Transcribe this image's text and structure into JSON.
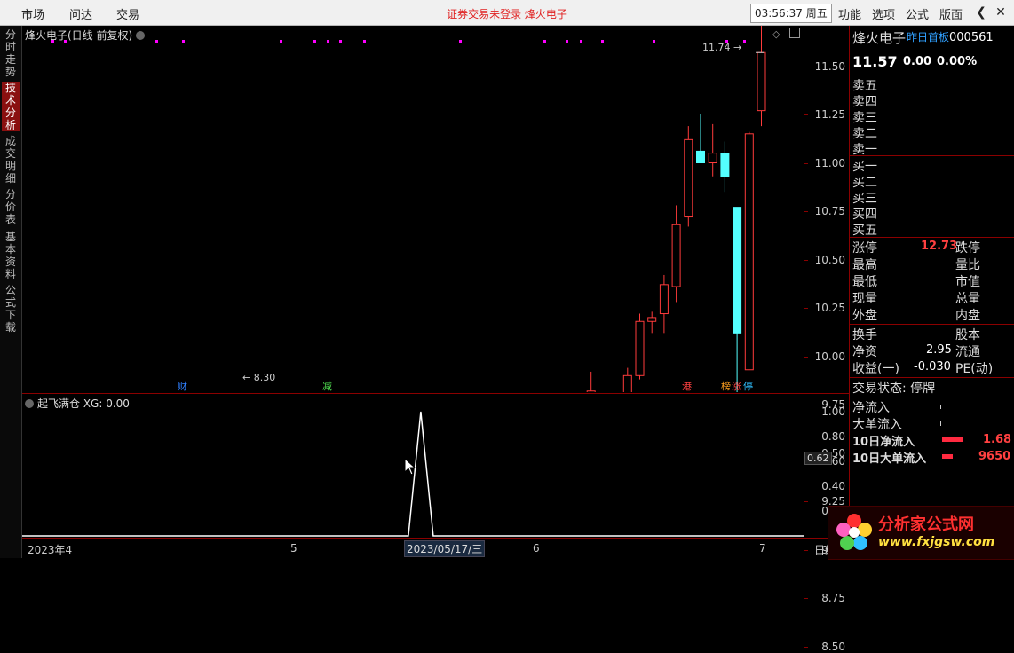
{
  "topbar": {
    "menus": [
      "市场",
      "问达",
      "交易"
    ],
    "center_title": "证券交易未登录   烽火电子",
    "clock": "03:56:37 周五",
    "right_menus": [
      "功能",
      "选项",
      "公式",
      "版面"
    ],
    "btn_back": "❮",
    "btn_close": "✕"
  },
  "vtabs": [
    {
      "label": "分时走势",
      "active": false
    },
    {
      "label": "技术分析",
      "active": true
    },
    {
      "label": "成交明细",
      "active": false
    },
    {
      "label": "分价表",
      "active": false
    },
    {
      "label": "基本资料",
      "active": false
    },
    {
      "label": "公式下载",
      "active": false
    }
  ],
  "main": {
    "title": "烽火电子(日线 前复权)",
    "max_label": "11.74",
    "min_label": "8.30",
    "y_ticks": [
      "11.50",
      "11.25",
      "11.00",
      "10.75",
      "10.50",
      "10.25",
      "10.00",
      "9.75",
      "9.50",
      "9.25",
      "9.00",
      "8.75",
      "8.50"
    ],
    "events": [
      "财",
      "减",
      "港",
      "榜",
      "涨",
      "停"
    ]
  },
  "sub": {
    "title": "起飞满仓  XG: 0.00",
    "y_ticks": [
      "1.00",
      "0.80",
      "0.60",
      "0.40",
      "0.20"
    ],
    "cursor_value": "0.62"
  },
  "xaxis": {
    "labels": [
      "2023年4",
      "5",
      "6",
      "7"
    ],
    "selected": "2023/05/17/三",
    "right_label": "日线"
  },
  "right_panel": {
    "name": "烽火电子",
    "tag": "昨日首板",
    "code": "000561",
    "price": "11.57",
    "change": "0.00",
    "change_pct": "0.00%",
    "sells": [
      "卖五",
      "卖四",
      "卖三",
      "卖二",
      "卖一"
    ],
    "buys": [
      "买一",
      "买二",
      "买三",
      "买四",
      "买五"
    ],
    "limit_up_label": "涨停",
    "limit_up_value": "12.73",
    "limit_down_label": "跌停",
    "rows_left": [
      "最高",
      "最低",
      "现量",
      "外盘"
    ],
    "rows_right": [
      "量比",
      "市值",
      "总量",
      "内盘"
    ],
    "turnover_label": "换手",
    "equity_label": "股本",
    "net_asset_label": "净资",
    "net_asset_value": "2.95",
    "float_label": "流通",
    "eps_label": "收益(一)",
    "eps_value": "-0.030",
    "pe_label": "PE(动)",
    "trade_status": "交易状态: 停牌",
    "flow_rows": [
      {
        "label": "净流入",
        "value": ""
      },
      {
        "label": "大单流入",
        "value": ""
      },
      {
        "label": "10日净流入",
        "value": "1.68"
      },
      {
        "label": "10日大单流入",
        "value": "9650"
      }
    ]
  },
  "logo": {
    "title": "分析家公式网",
    "url": "www.fxjgsw.com"
  },
  "colors": {
    "up": "#ff3b3b",
    "down": "#54ffff",
    "accent": "#8b0000",
    "marker": "#ff00ff"
  },
  "chart_data": {
    "type": "candlestick",
    "series": [
      {
        "o": 9.38,
        "h": 9.42,
        "l": 9.32,
        "c": 9.38
      },
      {
        "o": 9.4,
        "h": 9.42,
        "l": 9.14,
        "c": 9.2
      },
      {
        "o": 9.22,
        "h": 9.41,
        "l": 9.2,
        "c": 9.38
      },
      {
        "o": 9.38,
        "h": 9.54,
        "l": 9.35,
        "c": 9.48
      },
      {
        "o": 9.48,
        "h": 9.48,
        "l": 9.26,
        "c": 9.28
      },
      {
        "o": 9.27,
        "h": 9.36,
        "l": 9.22,
        "c": 9.33
      },
      {
        "o": 9.32,
        "h": 9.45,
        "l": 9.28,
        "c": 9.45
      },
      {
        "o": 9.44,
        "h": 9.44,
        "l": 9.2,
        "c": 9.21
      },
      {
        "o": 9.2,
        "h": 9.2,
        "l": 9.07,
        "c": 9.17
      },
      {
        "o": 9.18,
        "h": 9.35,
        "l": 9.16,
        "c": 9.33
      },
      {
        "o": 9.33,
        "h": 9.4,
        "l": 9.3,
        "c": 9.37
      },
      {
        "o": 9.35,
        "h": 9.44,
        "l": 9.33,
        "c": 9.38
      },
      {
        "o": 9.38,
        "h": 9.48,
        "l": 9.36,
        "c": 9.44
      },
      {
        "o": 9.4,
        "h": 9.4,
        "l": 9.12,
        "c": 9.12
      },
      {
        "o": 9.11,
        "h": 9.13,
        "l": 8.99,
        "c": 9.0
      },
      {
        "o": 8.97,
        "h": 9.05,
        "l": 8.92,
        "c": 8.97
      },
      {
        "o": 8.95,
        "h": 9.07,
        "l": 8.72,
        "c": 8.8
      },
      {
        "o": 8.78,
        "h": 8.82,
        "l": 8.69,
        "c": 8.74
      },
      {
        "o": 8.72,
        "h": 8.76,
        "l": 8.36,
        "c": 8.45
      },
      {
        "o": 8.43,
        "h": 8.65,
        "l": 8.4,
        "c": 8.55
      },
      {
        "o": 8.56,
        "h": 8.74,
        "l": 8.52,
        "c": 8.7
      },
      {
        "o": 8.62,
        "h": 8.85,
        "l": 8.6,
        "c": 8.83
      },
      {
        "o": 8.8,
        "h": 8.97,
        "l": 8.74,
        "c": 8.8
      },
      {
        "o": 8.73,
        "h": 8.87,
        "l": 8.7,
        "c": 8.82
      },
      {
        "o": 8.83,
        "h": 9.0,
        "l": 8.78,
        "c": 8.98
      },
      {
        "o": 9.03,
        "h": 9.09,
        "l": 8.83,
        "c": 8.86
      },
      {
        "o": 8.83,
        "h": 8.93,
        "l": 8.8,
        "c": 8.89
      },
      {
        "o": 8.88,
        "h": 9.02,
        "l": 8.85,
        "c": 8.98
      },
      {
        "o": 8.99,
        "h": 9.0,
        "l": 8.86,
        "c": 8.9
      },
      {
        "o": 8.93,
        "h": 8.97,
        "l": 8.74,
        "c": 8.95
      },
      {
        "o": 8.83,
        "h": 8.91,
        "l": 8.8,
        "c": 8.88
      },
      {
        "o": 8.9,
        "h": 9.09,
        "l": 8.87,
        "c": 9.06
      },
      {
        "o": 9.09,
        "h": 9.19,
        "l": 9.03,
        "c": 9.15
      },
      {
        "o": 9.16,
        "h": 9.18,
        "l": 9.1,
        "c": 9.15
      },
      {
        "o": 9.25,
        "h": 9.25,
        "l": 9.13,
        "c": 9.14
      },
      {
        "o": 9.14,
        "h": 9.16,
        "l": 8.99,
        "c": 9.03
      },
      {
        "o": 8.96,
        "h": 9.1,
        "l": 8.92,
        "c": 8.99
      },
      {
        "o": 8.98,
        "h": 9.12,
        "l": 8.91,
        "c": 9.07
      },
      {
        "o": 9.03,
        "h": 9.13,
        "l": 9.02,
        "c": 9.1
      },
      {
        "o": 9.14,
        "h": 9.16,
        "l": 9.0,
        "c": 9.03
      },
      {
        "o": 8.95,
        "h": 9.05,
        "l": 8.89,
        "c": 9.04
      },
      {
        "o": 9.01,
        "h": 9.18,
        "l": 8.96,
        "c": 9.14
      },
      {
        "o": 9.09,
        "h": 9.25,
        "l": 9.07,
        "c": 9.21
      },
      {
        "o": 9.21,
        "h": 9.3,
        "l": 9.19,
        "c": 9.29
      },
      {
        "o": 9.3,
        "h": 9.51,
        "l": 9.28,
        "c": 9.49
      },
      {
        "o": 9.77,
        "h": 9.8,
        "l": 9.52,
        "c": 9.55
      },
      {
        "o": 9.55,
        "h": 9.92,
        "l": 9.53,
        "c": 9.82
      },
      {
        "o": 9.68,
        "h": 9.8,
        "l": 9.65,
        "c": 9.7
      },
      {
        "o": 9.59,
        "h": 9.8,
        "l": 9.47,
        "c": 9.68
      },
      {
        "o": 9.68,
        "h": 9.94,
        "l": 9.65,
        "c": 9.9
      },
      {
        "o": 9.9,
        "h": 10.22,
        "l": 9.88,
        "c": 10.18
      },
      {
        "o": 10.18,
        "h": 10.23,
        "l": 10.12,
        "c": 10.2
      },
      {
        "o": 10.22,
        "h": 10.42,
        "l": 10.12,
        "c": 10.37
      },
      {
        "o": 10.36,
        "h": 10.78,
        "l": 10.28,
        "c": 10.68
      },
      {
        "o": 10.72,
        "h": 11.19,
        "l": 10.67,
        "c": 11.12
      },
      {
        "o": 11.06,
        "h": 11.25,
        "l": 11.02,
        "c": 11.0
      },
      {
        "o": 11.0,
        "h": 11.2,
        "l": 10.93,
        "c": 11.05
      },
      {
        "o": 11.05,
        "h": 11.11,
        "l": 10.85,
        "c": 10.93
      },
      {
        "o": 10.77,
        "h": 10.77,
        "l": 9.79,
        "c": 10.12
      },
      {
        "o": 9.93,
        "h": 11.16,
        "l": 9.93,
        "c": 11.15
      },
      {
        "o": 11.27,
        "h": 11.74,
        "l": 11.19,
        "c": 11.57
      }
    ],
    "ylim": [
      8.3,
      11.74
    ],
    "signal": {
      "title": "起飞满仓",
      "value_index": 32,
      "ylim": [
        0,
        1
      ],
      "peak": 1.0
    }
  }
}
